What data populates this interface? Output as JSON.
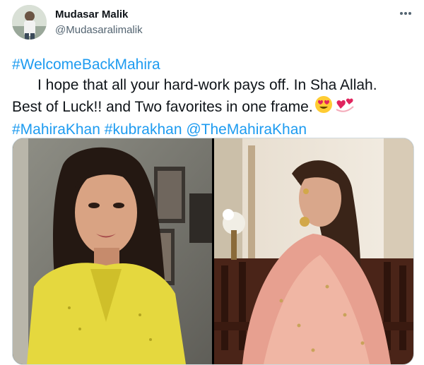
{
  "author": {
    "name": "Mudasar Malik",
    "handle": "@Mudasaralimalik",
    "avatar_icon": "profile-photo"
  },
  "more_icon": "more-horizontal-icon",
  "tweet": {
    "line1_tag": "#WelcomeBackMahira",
    "line2_text": "I hope that all your hard-work pays off. In Sha Allah.",
    "line3_text": "Best of Luck!!  and Two favorites in one frame.",
    "emojis": [
      "smiling-face-with-heart-eyes",
      "revolving-hearts"
    ],
    "tags": [
      "#MahiraKhan",
      "#kubrakhan",
      "@TheMahiraKhan"
    ]
  },
  "media": {
    "photos": [
      "photo-woman-yellow-outfit",
      "photo-woman-pink-dupatta"
    ]
  },
  "colors": {
    "link": "#1d9bf0",
    "text": "#0f1419",
    "secondary": "#536471",
    "border": "#cfd9de"
  }
}
